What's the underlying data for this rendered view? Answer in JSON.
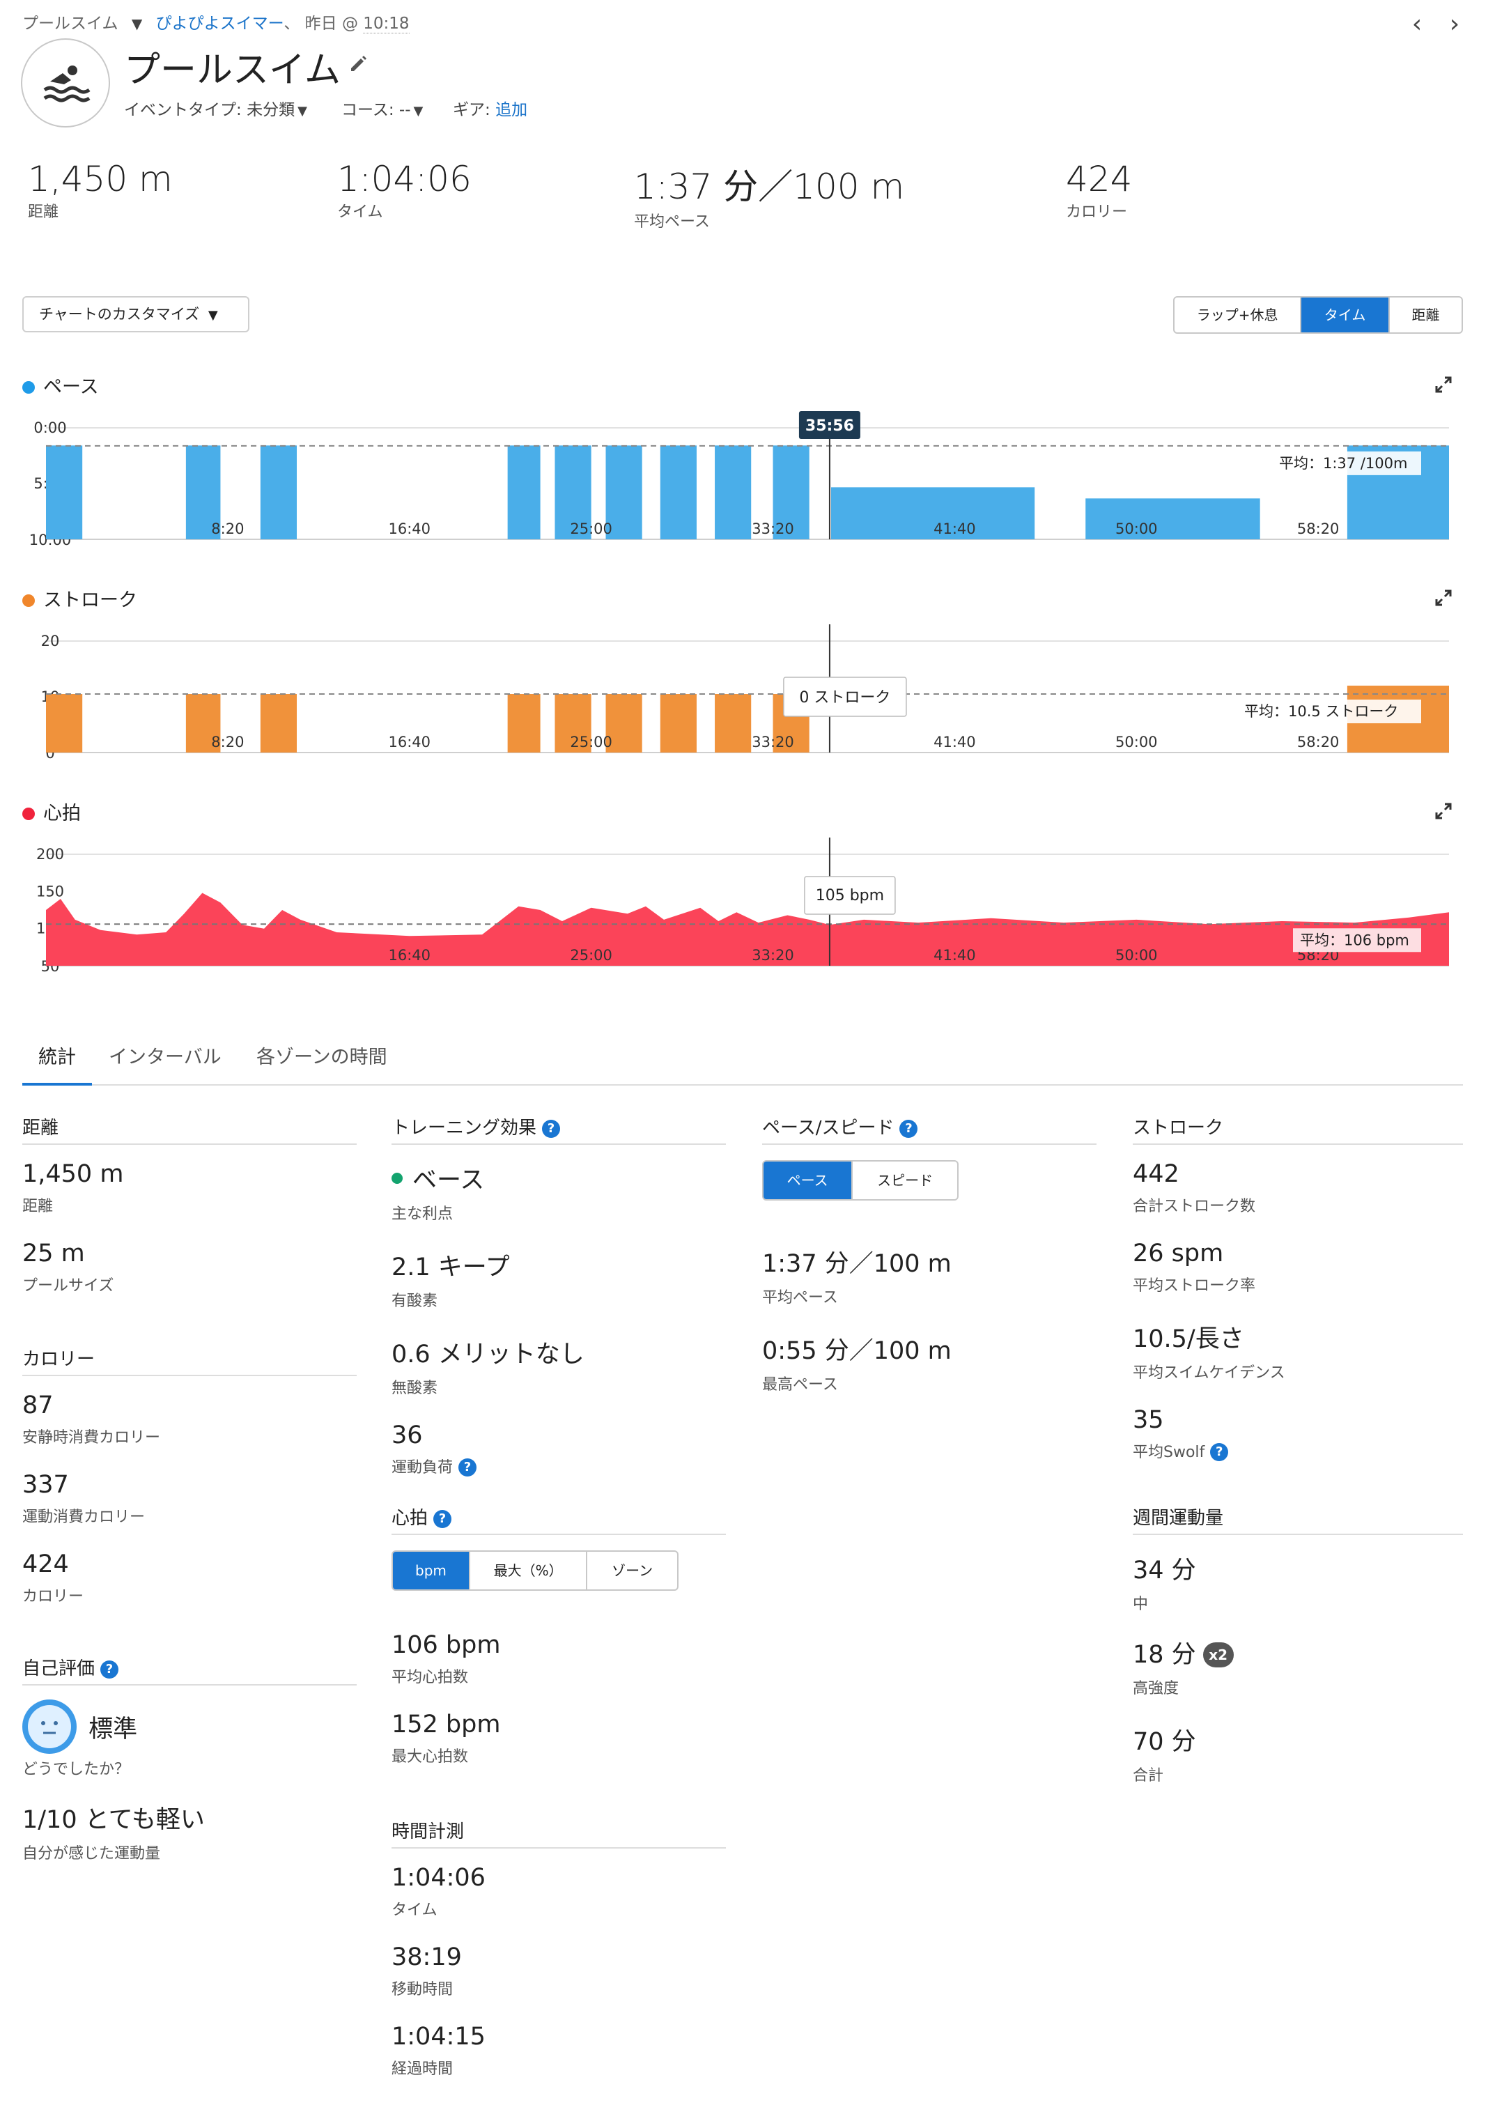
{
  "breadcrumb": {
    "activity_type": "プールスイム",
    "user": "ぴよぴよスイマー",
    "separator": "、",
    "day": "昨日",
    "at": "@",
    "time": "10:18"
  },
  "header": {
    "title": "プールスイム",
    "event_type_label": "イベントタイプ:",
    "event_type_value": "未分類",
    "course_label": "コース:",
    "course_value": "--",
    "gear_label": "ギア:",
    "gear_link": "追加"
  },
  "kpis": [
    {
      "value": "1,450 m",
      "label": "距離"
    },
    {
      "value": "1:04:06",
      "label": "タイム"
    },
    {
      "value": "1:37 分／100 m",
      "label": "平均ペース"
    },
    {
      "value": "424",
      "label": "カロリー"
    }
  ],
  "controls": {
    "customize": "チャートのカスタマイズ",
    "seg": [
      "ラップ+休息",
      "タイム",
      "距離"
    ],
    "seg_active": 1
  },
  "chart_data": [
    {
      "type": "bar",
      "title": "ペース",
      "color": "#4aaee9",
      "x_ticks": [
        "8:20",
        "16:40",
        "25:00",
        "33:20",
        "41:40",
        "50:00",
        "58:20"
      ],
      "y_ticks": [
        "0:00",
        "5:00",
        "10:00"
      ],
      "ylim_sec_per_100m": [
        0,
        600
      ],
      "y_reversed": true,
      "xlim_sec": [
        0,
        3860
      ],
      "cursor_label": "35:56",
      "cursor_sec": 2156,
      "avg_label": "平均：1:37 /100m",
      "avg_pace_sec": 97,
      "segments": [
        {
          "start": 0,
          "end": 100,
          "pace": 95
        },
        {
          "start": 385,
          "end": 480,
          "pace": 95
        },
        {
          "start": 590,
          "end": 690,
          "pace": 95
        },
        {
          "start": 1270,
          "end": 1360,
          "pace": 95
        },
        {
          "start": 1400,
          "end": 1500,
          "pace": 95
        },
        {
          "start": 1540,
          "end": 1640,
          "pace": 95
        },
        {
          "start": 1690,
          "end": 1790,
          "pace": 95
        },
        {
          "start": 1840,
          "end": 1940,
          "pace": 95
        },
        {
          "start": 2000,
          "end": 2100,
          "pace": 95
        },
        {
          "start": 2160,
          "end": 2720,
          "pace": 320
        },
        {
          "start": 2860,
          "end": 3340,
          "pace": 380
        },
        {
          "start": 3580,
          "end": 3860,
          "pace": 95
        }
      ]
    },
    {
      "type": "bar",
      "title": "ストローク",
      "color": "#f0923b",
      "x_ticks": [
        "8:20",
        "16:40",
        "25:00",
        "33:20",
        "41:40",
        "50:00",
        "58:20"
      ],
      "y_ticks": [
        "20",
        "10",
        "0"
      ],
      "ylim": [
        0,
        20
      ],
      "xlim_sec": [
        0,
        3860
      ],
      "cursor_label": "0 ストローク",
      "cursor_sec": 2156,
      "avg_label": "平均：10.5 ストローク",
      "avg_value": 10.5,
      "segments": [
        {
          "start": 0,
          "end": 100,
          "value": 10.5
        },
        {
          "start": 385,
          "end": 480,
          "value": 10.5
        },
        {
          "start": 590,
          "end": 690,
          "value": 10.5
        },
        {
          "start": 1270,
          "end": 1360,
          "value": 10.5
        },
        {
          "start": 1400,
          "end": 1500,
          "value": 10.5
        },
        {
          "start": 1540,
          "end": 1640,
          "value": 10.5
        },
        {
          "start": 1690,
          "end": 1790,
          "value": 10.5
        },
        {
          "start": 1840,
          "end": 1940,
          "value": 10.5
        },
        {
          "start": 2000,
          "end": 2100,
          "value": 10.5
        },
        {
          "start": 3580,
          "end": 3860,
          "value": 12
        }
      ]
    },
    {
      "type": "area",
      "title": "心拍",
      "color": "#fb4459",
      "x_ticks": [
        "16:40",
        "25:00",
        "33:20",
        "41:40",
        "50:00",
        "58:20"
      ],
      "y_ticks": [
        "200",
        "150",
        "100",
        "50"
      ],
      "ylim": [
        50,
        200
      ],
      "xlim_sec": [
        0,
        3860
      ],
      "cursor_label": "105 bpm",
      "cursor_sec": 2156,
      "avg_label": "平均：106 bpm",
      "avg_value": 106,
      "series": [
        {
          "t": 0,
          "bpm": 125
        },
        {
          "t": 40,
          "bpm": 140
        },
        {
          "t": 80,
          "bpm": 112
        },
        {
          "t": 150,
          "bpm": 98
        },
        {
          "t": 250,
          "bpm": 92
        },
        {
          "t": 330,
          "bpm": 95
        },
        {
          "t": 380,
          "bpm": 120
        },
        {
          "t": 430,
          "bpm": 148
        },
        {
          "t": 480,
          "bpm": 135
        },
        {
          "t": 540,
          "bpm": 105
        },
        {
          "t": 600,
          "bpm": 100
        },
        {
          "t": 650,
          "bpm": 125
        },
        {
          "t": 700,
          "bpm": 112
        },
        {
          "t": 800,
          "bpm": 95
        },
        {
          "t": 1000,
          "bpm": 90
        },
        {
          "t": 1200,
          "bpm": 92
        },
        {
          "t": 1300,
          "bpm": 130
        },
        {
          "t": 1360,
          "bpm": 125
        },
        {
          "t": 1420,
          "bpm": 110
        },
        {
          "t": 1500,
          "bpm": 128
        },
        {
          "t": 1600,
          "bpm": 120
        },
        {
          "t": 1650,
          "bpm": 130
        },
        {
          "t": 1700,
          "bpm": 112
        },
        {
          "t": 1800,
          "bpm": 128
        },
        {
          "t": 1850,
          "bpm": 110
        },
        {
          "t": 1900,
          "bpm": 122
        },
        {
          "t": 1960,
          "bpm": 108
        },
        {
          "t": 2040,
          "bpm": 118
        },
        {
          "t": 2100,
          "bpm": 112
        },
        {
          "t": 2156,
          "bpm": 105
        },
        {
          "t": 2250,
          "bpm": 112
        },
        {
          "t": 2400,
          "bpm": 108
        },
        {
          "t": 2600,
          "bpm": 114
        },
        {
          "t": 2800,
          "bpm": 108
        },
        {
          "t": 3000,
          "bpm": 112
        },
        {
          "t": 3200,
          "bpm": 106
        },
        {
          "t": 3400,
          "bpm": 110
        },
        {
          "t": 3600,
          "bpm": 108
        },
        {
          "t": 3750,
          "bpm": 115
        },
        {
          "t": 3860,
          "bpm": 122
        }
      ]
    }
  ],
  "tabs": [
    "統計",
    "インターバル",
    "各ゾーンの時間"
  ],
  "tab_active": 0,
  "stats": {
    "distance": {
      "heading": "距離",
      "items": [
        {
          "value": "1,450 m",
          "label": "距離"
        },
        {
          "value": "25 m",
          "label": "プールサイズ"
        }
      ]
    },
    "calories": {
      "heading": "カロリー",
      "items": [
        {
          "value": "87",
          "label": "安静時消費カロリー"
        },
        {
          "value": "337",
          "label": "運動消費カロリー"
        },
        {
          "value": "424",
          "label": "カロリー"
        }
      ]
    },
    "self_eval": {
      "heading": "自己評価",
      "feeling_value": "標準",
      "feeling_label": "どうでしたか？",
      "effort_value": "1/10 とても軽い",
      "effort_label": "自分が感じた運動量"
    },
    "training": {
      "heading": "トレーニング効果",
      "primary_value": "ベース",
      "primary_label": "主な利点",
      "aerobic_value": "2.1 キープ",
      "aerobic_label": "有酸素",
      "anaerobic_value": "0.6 メリットなし",
      "anaerobic_label": "無酸素",
      "load_value": "36",
      "load_label": "運動負荷"
    },
    "hr": {
      "heading": "心拍",
      "seg": [
        "bpm",
        "最大（%）",
        "ゾーン"
      ],
      "avg_value": "106 bpm",
      "avg_label": "平均心拍数",
      "max_value": "152 bpm",
      "max_label": "最大心拍数"
    },
    "timing": {
      "heading": "時間計測",
      "items": [
        {
          "value": "1:04:06",
          "label": "タイム"
        },
        {
          "value": "38:19",
          "label": "移動時間"
        },
        {
          "value": "1:04:15",
          "label": "経過時間"
        }
      ]
    },
    "pace": {
      "heading": "ペース/スピード",
      "seg": [
        "ペース",
        "スピード"
      ],
      "items": [
        {
          "value": "1:37 分／100 m",
          "label": "平均ペース"
        },
        {
          "value": "0:55 分／100 m",
          "label": "最高ペース"
        }
      ]
    },
    "stroke": {
      "heading": "ストローク",
      "items": [
        {
          "value": "442",
          "label": "合計ストローク数"
        },
        {
          "value": "26 spm",
          "label": "平均ストローク率"
        },
        {
          "value": "10.5/長さ",
          "label": "平均スイムケイデンス"
        },
        {
          "value": "35",
          "label": "平均Swolf"
        }
      ]
    },
    "weekly": {
      "heading": "週間運動量",
      "mod_value": "34 分",
      "mod_label": "中",
      "vig_value": "18 分",
      "vig_badge": "x2",
      "vig_label": "高強度",
      "total_value": "70 分",
      "total_label": "合計"
    }
  }
}
